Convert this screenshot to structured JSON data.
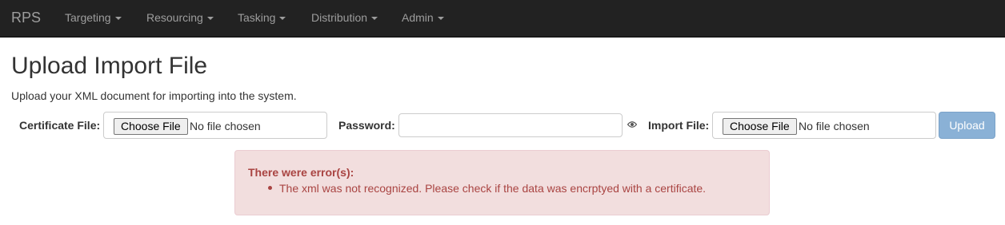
{
  "navbar": {
    "brand": "RPS",
    "items": [
      {
        "label": "Targeting"
      },
      {
        "label": "Resourcing"
      },
      {
        "label": "Tasking"
      },
      {
        "label": "Distribution"
      },
      {
        "label": "Admin"
      }
    ]
  },
  "page": {
    "title": "Upload Import File",
    "lead": "Upload your XML document for importing into the system."
  },
  "form": {
    "certificate_label": "Certificate File:",
    "certificate_button": "Choose File",
    "certificate_status": "No file chosen",
    "password_label": "Password:",
    "password_value": "",
    "import_label": "Import File:",
    "import_button": "Choose File",
    "import_status": "No file chosen",
    "upload_label": "Upload"
  },
  "alert": {
    "heading": "There were error(s):",
    "errors": [
      "The xml was not recognized. Please check if the data was encrptyed with a certificate."
    ]
  },
  "colors": {
    "navbar_bg": "#222222",
    "alert_bg": "#f2dede",
    "alert_text": "#a94442",
    "upload_button_bg": "#8ab1d6"
  }
}
